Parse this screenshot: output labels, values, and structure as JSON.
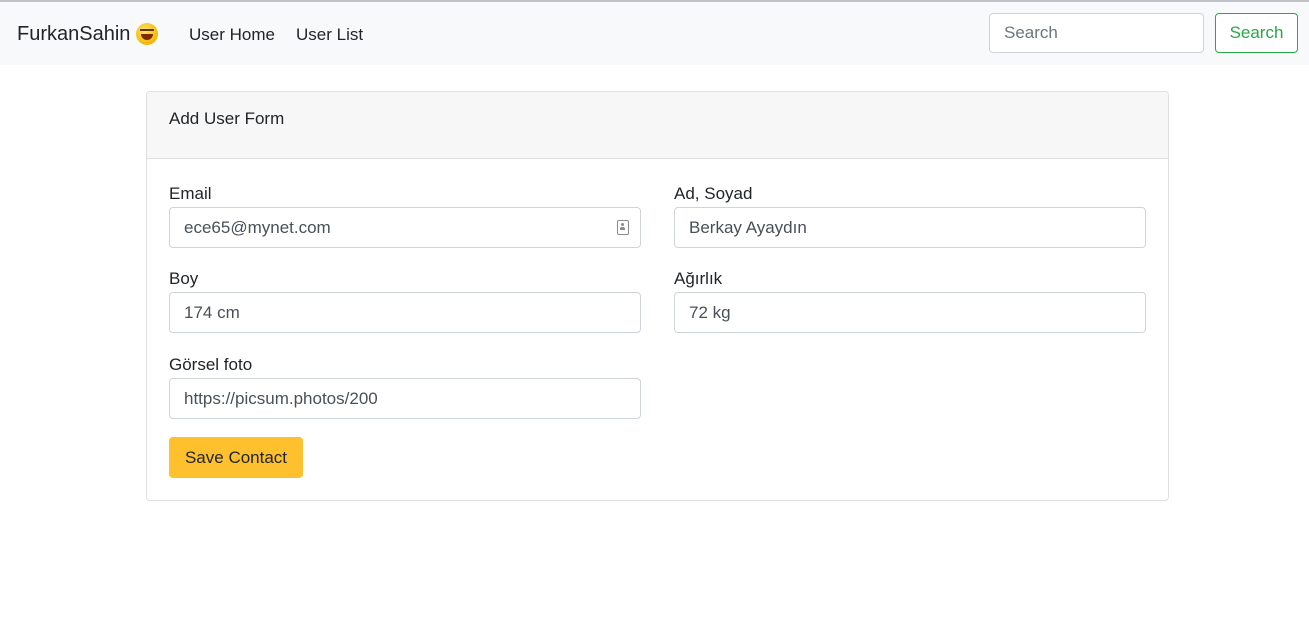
{
  "navbar": {
    "brand": "FurkanSahin",
    "brand_emoji_icon": "grinning-squinting-face-icon",
    "links": [
      "User Home",
      "User List"
    ],
    "search": {
      "placeholder": "Search",
      "button_label": "Search"
    }
  },
  "form": {
    "title": "Add User Form",
    "fields": {
      "email": {
        "label": "Email",
        "value": "ece65@mynet.com"
      },
      "name": {
        "label": "Ad, Soyad",
        "value": "Berkay Ayaydın"
      },
      "height": {
        "label": "Boy",
        "value": "174 cm"
      },
      "weight": {
        "label": "Ağırlık",
        "value": "72 kg"
      },
      "photo": {
        "label": "Görsel foto",
        "value": "https://picsum.photos/200"
      }
    },
    "save_label": "Save Contact"
  },
  "colors": {
    "navbar_bg": "#f8f9fa",
    "search_button": "#28a745",
    "save_button": "#ffc02d"
  }
}
